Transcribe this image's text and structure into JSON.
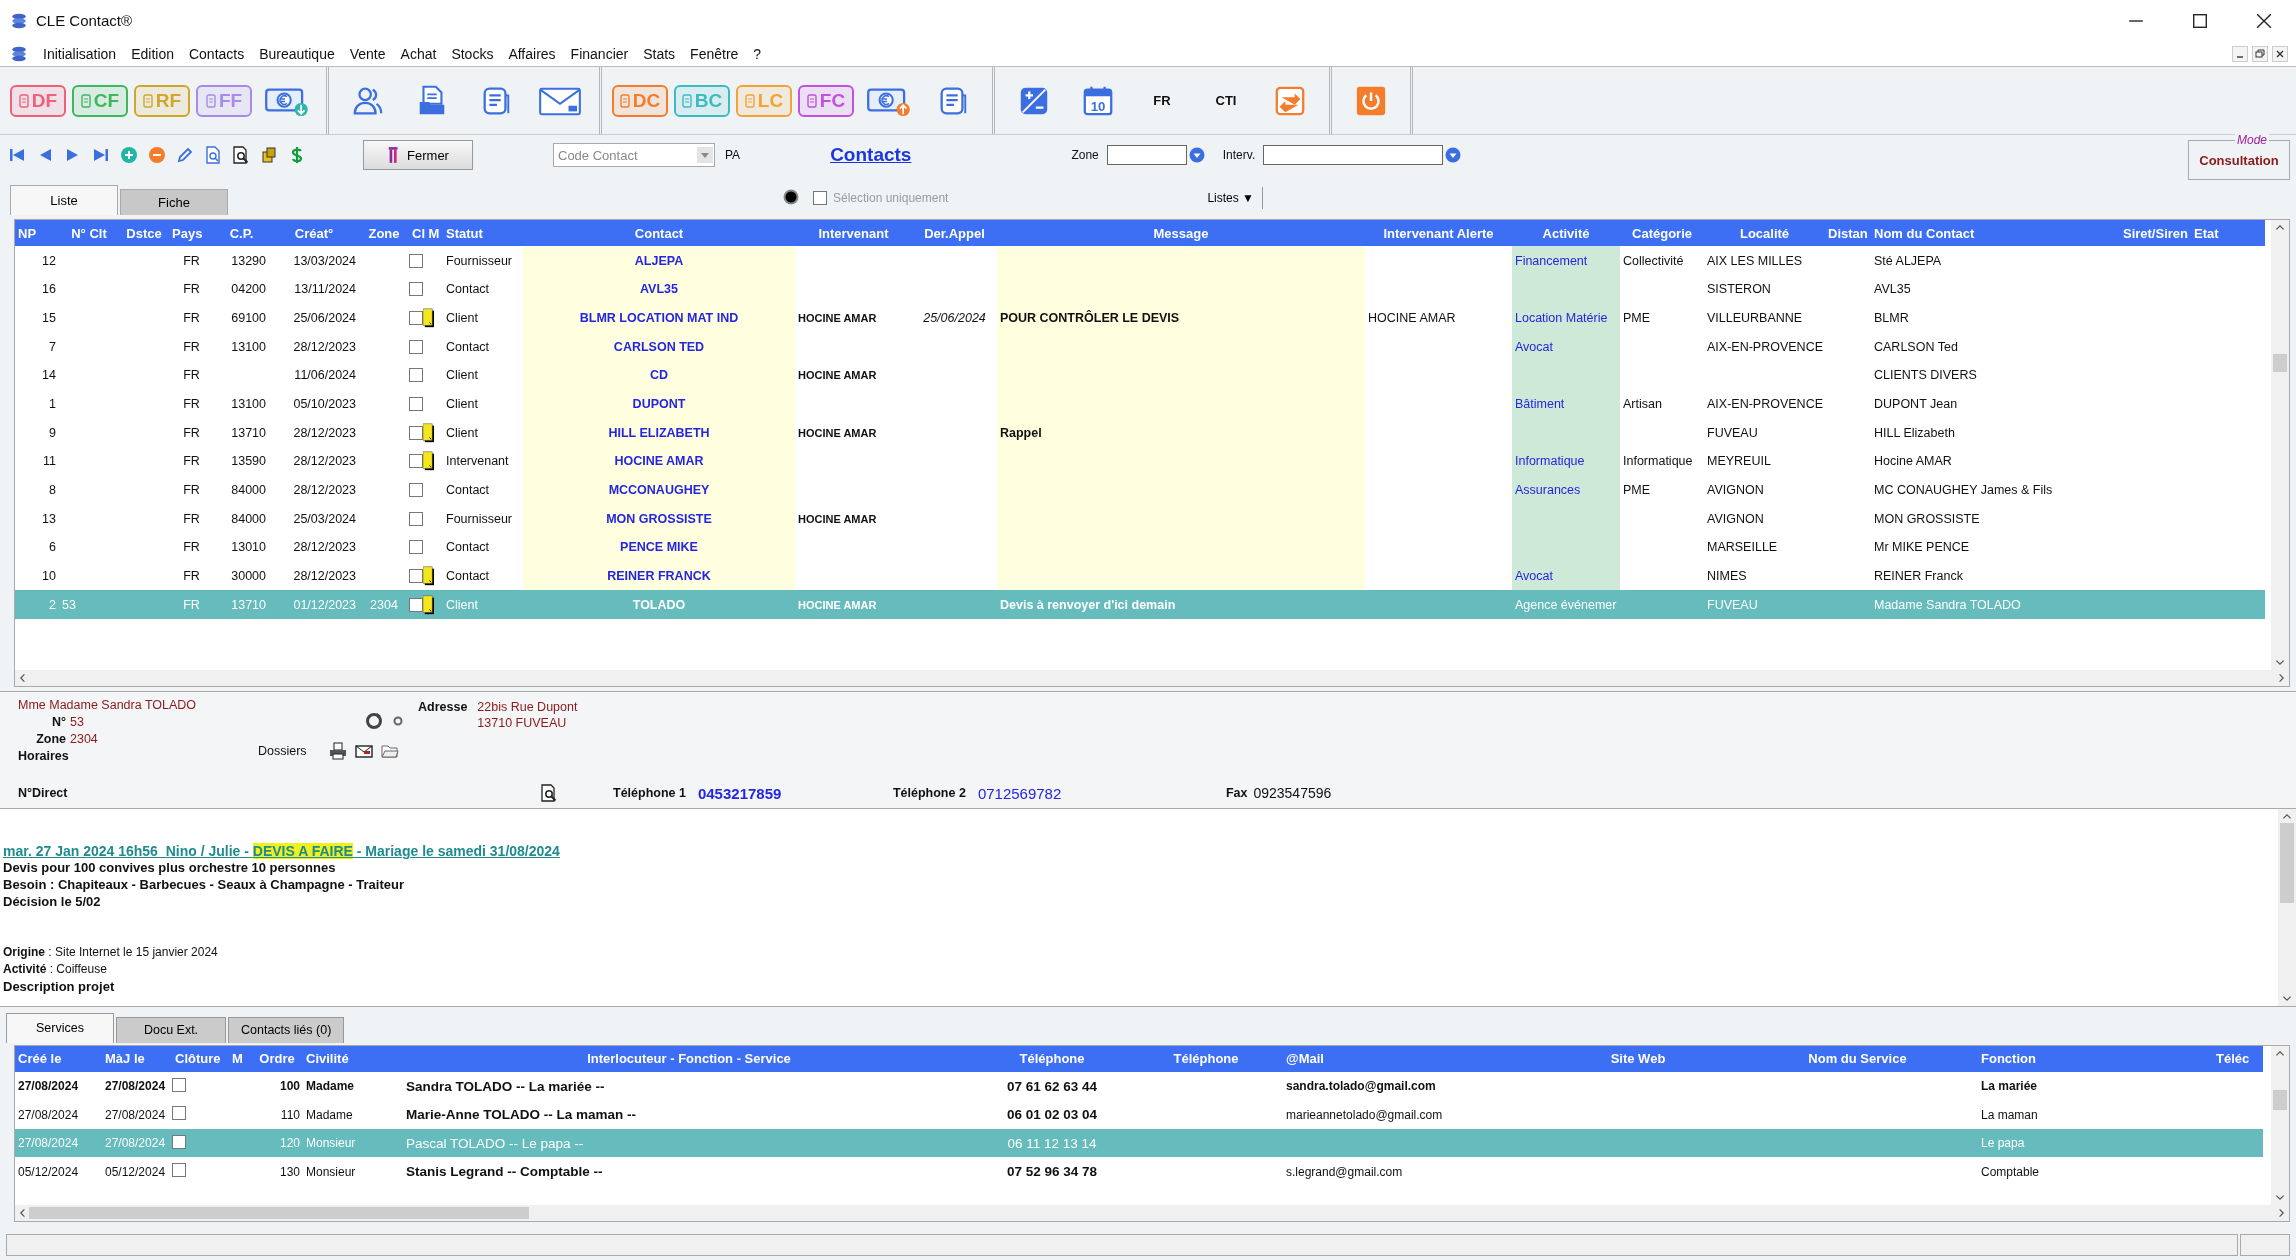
{
  "window": {
    "title": "CLE Contact®"
  },
  "menu": [
    "Initialisation",
    "Edition",
    "Contacts",
    "Bureautique",
    "Vente",
    "Achat",
    "Stocks",
    "Affaires",
    "Financier",
    "Stats",
    "Fenêtre",
    "?"
  ],
  "toolbar": [
    {
      "items": [
        {
          "kind": "badge",
          "label": "DF",
          "color": "#f0607a"
        },
        {
          "kind": "badge",
          "label": "CF",
          "color": "#3cb95a"
        },
        {
          "kind": "badge",
          "label": "RF",
          "color": "#d2a52c"
        },
        {
          "kind": "badge",
          "label": "FF",
          "color": "#a98ae8"
        },
        {
          "kind": "money-down"
        }
      ]
    },
    {
      "items": [
        {
          "kind": "people"
        },
        {
          "kind": "document"
        },
        {
          "kind": "list"
        },
        {
          "kind": "envelope"
        }
      ]
    },
    {
      "items": [
        {
          "kind": "badge",
          "label": "DC",
          "color": "#f57c2a"
        },
        {
          "kind": "badge",
          "label": "BC",
          "color": "#3bbcc0"
        },
        {
          "kind": "badge",
          "label": "LC",
          "color": "#f7a134"
        },
        {
          "kind": "badge",
          "label": "FC",
          "color": "#c54fe0"
        },
        {
          "kind": "money-up"
        },
        {
          "kind": "list"
        }
      ]
    },
    {
      "items": [
        {
          "kind": "calculator"
        },
        {
          "kind": "calendar",
          "label": "10"
        },
        {
          "kind": "text",
          "label": "FR"
        },
        {
          "kind": "text",
          "label": "CTI"
        },
        {
          "kind": "swap"
        }
      ]
    },
    {
      "items": [
        {
          "kind": "power"
        }
      ]
    }
  ],
  "nav": {
    "close_button": "Fermer",
    "code_field": {
      "placeholder": "Code Contact"
    },
    "code_suffix": "PA",
    "title": "Contacts",
    "zone": {
      "label": "Zone"
    },
    "interv": {
      "label": "Interv."
    },
    "mode": {
      "legend": "Mode",
      "value": "Consultation"
    },
    "selection": {
      "label": "Sélection uniquement",
      "checked": false,
      "disabled": true
    },
    "lists_button": "Listes ▼"
  },
  "view_tabs": [
    {
      "label": "Liste",
      "selected": true
    },
    {
      "label": "Fiche",
      "selected": false
    }
  ],
  "table": {
    "columns": [
      "NP",
      "N° Clt",
      "Dstce",
      "Pays",
      "C.P.",
      "Créat°",
      "Zone",
      "Cl M",
      "Statut",
      "Contact",
      "Intervenant",
      "Der.Appel",
      "Message",
      "Intervenant Alerte",
      "Activité",
      "Catégorie",
      "Localité",
      "Distan",
      "Nom du Contact",
      "Siret/Siren",
      "Etat"
    ],
    "rows": [
      {
        "np": "12",
        "country": "FR",
        "postcode": "13290",
        "created": "13/03/2024",
        "closed": false,
        "memo": false,
        "status": "Fournisseur",
        "contact": "ALJEPA",
        "activity": "Financement",
        "category": "Collectivité",
        "city": "AIX LES MILLES",
        "contact_name": "Sté ALJEPA",
        "selected": false
      },
      {
        "np": "16",
        "country": "FR",
        "postcode": "04200",
        "created": "13/11/2024",
        "closed": false,
        "memo": false,
        "status": "Contact",
        "contact": "AVL35",
        "city": "SISTERON",
        "contact_name": "AVL35",
        "selected": false
      },
      {
        "np": "15",
        "country": "FR",
        "postcode": "69100",
        "created": "25/06/2024",
        "closed": false,
        "memo": true,
        "status": "Client",
        "contact": "BLMR LOCATION MAT IND",
        "intervenant": "HOCINE AMAR",
        "last_call": "25/06/2024",
        "message": "POUR CONTRÔLER LE DEVIS",
        "alert_intervenant": "HOCINE AMAR",
        "activity": "Location Matérie",
        "category": "PME",
        "city": "VILLEURBANNE",
        "contact_name": "BLMR",
        "selected": false
      },
      {
        "np": "7",
        "country": "FR",
        "postcode": "13100",
        "created": "28/12/2023",
        "closed": false,
        "memo": false,
        "status": "Contact",
        "contact": "CARLSON TED",
        "activity": "Avocat",
        "city": "AIX-EN-PROVENCE",
        "contact_name": "CARLSON Ted",
        "selected": false
      },
      {
        "np": "14",
        "country": "FR",
        "created": "11/06/2024",
        "closed": false,
        "memo": false,
        "status": "Client",
        "contact": "CD",
        "intervenant": "HOCINE AMAR",
        "contact_name": "CLIENTS DIVERS",
        "selected": false
      },
      {
        "np": "1",
        "country": "FR",
        "postcode": "13100",
        "created": "05/10/2023",
        "closed": false,
        "memo": false,
        "status": "Client",
        "contact": "DUPONT",
        "activity": "Bâtiment",
        "category": "Artisan",
        "city": "AIX-EN-PROVENCE",
        "contact_name": "DUPONT Jean",
        "selected": false
      },
      {
        "np": "9",
        "country": "FR",
        "postcode": "13710",
        "created": "28/12/2023",
        "closed": false,
        "memo": true,
        "status": "Client",
        "contact": "HILL ELIZABETH",
        "intervenant": "HOCINE AMAR",
        "message": "Rappel",
        "city": "FUVEAU",
        "contact_name": "HILL Elizabeth",
        "selected": false
      },
      {
        "np": "11",
        "country": "FR",
        "postcode": "13590",
        "created": "28/12/2023",
        "closed": false,
        "memo": true,
        "status": "Intervenant",
        "contact": "HOCINE AMAR",
        "activity": "Informatique",
        "category": "Informatique",
        "city": "MEYREUIL",
        "contact_name": "Hocine AMAR",
        "selected": false
      },
      {
        "np": "8",
        "country": "FR",
        "postcode": "84000",
        "created": "28/12/2023",
        "closed": false,
        "memo": false,
        "status": "Contact",
        "contact": "MCCONAUGHEY",
        "activity": "Assurances",
        "category": "PME",
        "city": "AVIGNON",
        "contact_name": "MC CONAUGHEY James & Fils",
        "selected": false
      },
      {
        "np": "13",
        "country": "FR",
        "postcode": "84000",
        "created": "25/03/2024",
        "closed": false,
        "memo": false,
        "status": "Fournisseur",
        "contact": "MON GROSSISTE",
        "intervenant": "HOCINE AMAR",
        "city": "AVIGNON",
        "contact_name": "MON GROSSISTE",
        "selected": false
      },
      {
        "np": "6",
        "country": "FR",
        "postcode": "13010",
        "created": "28/12/2023",
        "closed": false,
        "memo": false,
        "status": "Contact",
        "contact": "PENCE MIKE",
        "city": "MARSEILLE",
        "contact_name": "Mr MIKE PENCE",
        "selected": false
      },
      {
        "np": "10",
        "country": "FR",
        "postcode": "30000",
        "created": "28/12/2023",
        "closed": false,
        "memo": true,
        "status": "Contact",
        "contact": "REINER FRANCK",
        "activity": "Avocat",
        "city": "NIMES",
        "contact_name": "REINER Franck",
        "selected": false
      },
      {
        "np": "2",
        "client_no": "53",
        "country": "FR",
        "postcode": "13710",
        "created": "01/12/2023",
        "zone": "2304",
        "closed": false,
        "memo": true,
        "status": "Client",
        "contact": "TOLADO",
        "intervenant": "HOCINE AMAR",
        "message": "Devis à renvoyer d'ici demain",
        "activity": "Agence événemer",
        "city": "FUVEAU",
        "contact_name": "Madame Sandra TOLADO",
        "selected": true
      }
    ]
  },
  "detail": {
    "civility_name": "Mme Madame Sandra TOLADO",
    "number": {
      "label": "N°",
      "value": "53"
    },
    "zone": {
      "label": "Zone",
      "value": "2304"
    },
    "hours": {
      "label": "Horaires"
    },
    "folders": {
      "label": "Dossiers"
    },
    "address": {
      "label": "Adresse",
      "lines": [
        "22bis Rue Dupont",
        "13710 FUVEAU"
      ]
    },
    "direct": {
      "label": "N°Direct"
    },
    "phone1": {
      "label": "Téléphone 1",
      "value": "0453217859"
    },
    "phone2": {
      "label": "Téléphone 2",
      "value": "0712569782"
    },
    "fax": {
      "label": "Fax",
      "value": "0923547596"
    }
  },
  "notes": {
    "heading": {
      "before": "mar. 27 Jan 2024 16h56  Nino / Julie - ",
      "highlight": "DEVIS A FAIRE",
      "after": " - Mariage le samedi 31/08/2024"
    },
    "lines": [
      "Devis pour 100 convives plus orchestre 10 personnes",
      "Besoin : Chapiteaux - Barbecues - Seaux à Champagne - Traiteur",
      "Décision le 5/02"
    ],
    "info": [
      "**Origine** : Site Internet le 15 janvier 2024",
      "**Activité** : Coiffeuse"
    ],
    "footer": "Description projet"
  },
  "bottom_tabs": [
    {
      "label": "Services",
      "selected": true
    },
    {
      "label": "Docu Ext.",
      "selected": false
    },
    {
      "label": "Contacts liés (0)",
      "selected": false
    }
  ],
  "services": {
    "columns": [
      "Créé le",
      "MàJ le",
      "Clôture",
      "M",
      "Ordre",
      "Civilité",
      "Interlocuteur - Fonction - Service",
      "Téléphone",
      "Téléphone",
      "@Mail",
      "Site Web",
      "Nom du Service",
      "Fonction",
      "Téléc"
    ],
    "rows": [
      {
        "created": "27/08/2024",
        "updated": "27/08/2024",
        "closed": false,
        "order": "100",
        "civility": "Madame",
        "contact": "Sandra TOLADO -- La mariée --",
        "phone": "07 61 62 63 44",
        "email": "sandra.tolado@gmail.com",
        "function": "La mariée",
        "bold": true,
        "selected": false
      },
      {
        "created": "27/08/2024",
        "updated": "27/08/2024",
        "closed": false,
        "order": "110",
        "civility": "Madame",
        "contact": "Marie-Anne TOLADO -- La maman --",
        "phone": "06 01 02 03 04",
        "email": "marieannetolado@gmail.com",
        "function": "La maman",
        "bold": false,
        "selected": false
      },
      {
        "created": "27/08/2024",
        "updated": "27/08/2024",
        "closed": false,
        "order": "120",
        "civility": "Monsieur",
        "contact": "Pascal TOLADO -- Le papa --",
        "phone": "06 11 12 13 14",
        "function": "Le papa",
        "bold": false,
        "selected": true
      },
      {
        "created": "05/12/2024",
        "updated": "05/12/2024",
        "closed": false,
        "order": "130",
        "civility": "Monsieur",
        "contact": "Stanis Legrand -- Comptable --",
        "phone": "07 52 96 34 78",
        "email": "s.legrand@gmail.com",
        "function": "Comptable",
        "bold": false,
        "selected": false
      }
    ]
  }
}
